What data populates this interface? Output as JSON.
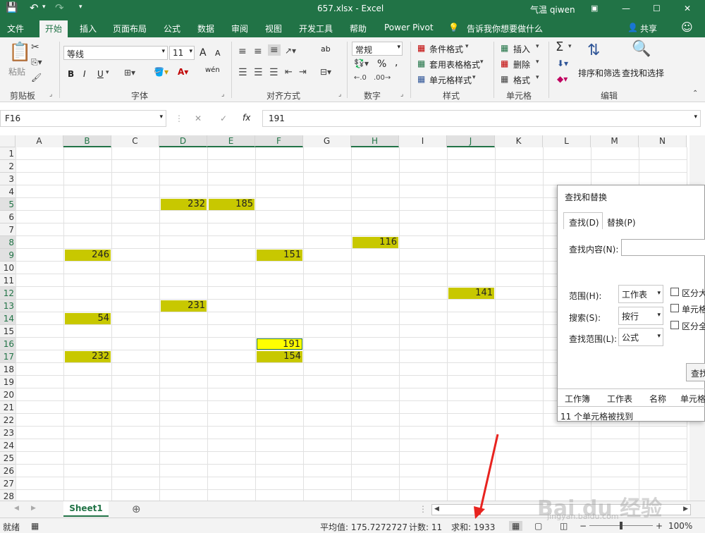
{
  "window": {
    "title": "657.xlsx  -  Excel",
    "user": "气温 qiwen",
    "buttons": {
      "minimize": "—",
      "restore": "☐",
      "close": "✕"
    }
  },
  "ribbon_tabs": [
    "文件",
    "开始",
    "插入",
    "页面布局",
    "公式",
    "数据",
    "审阅",
    "视图",
    "开发工具",
    "帮助",
    "Power Pivot"
  ],
  "tell_me": "告诉我你想要做什么",
  "share": "共享",
  "ribbon": {
    "clipboard": {
      "paste": "粘贴",
      "label": "剪贴板"
    },
    "font": {
      "name": "等线",
      "size": "11",
      "label": "字体",
      "bold": "B",
      "italic": "I",
      "underline": "U",
      "grow": "A",
      "shrink": "A",
      "wen": "wén"
    },
    "alignment": {
      "label": "对齐方式",
      "wrap": "ab"
    },
    "number": {
      "format": "常规",
      "label": "数字",
      "percent": "%",
      "comma": ","
    },
    "styles": {
      "conditional": "条件格式",
      "table": "套用表格格式",
      "cell": "单元格样式",
      "label": "样式"
    },
    "cells": {
      "insert": "插入",
      "delete": "删除",
      "format": "格式",
      "label": "单元格"
    },
    "editing": {
      "sort": "排序和筛选",
      "find": "查找和选择",
      "label": "编辑"
    }
  },
  "formula_bar": {
    "name_box": "F16",
    "cancel": "✕",
    "enter": "✓",
    "fx": "fx",
    "value": "191"
  },
  "sheet": {
    "columns": [
      "A",
      "B",
      "C",
      "D",
      "E",
      "F",
      "G",
      "H",
      "I",
      "J",
      "K",
      "L",
      "M",
      "N"
    ],
    "rows": [
      "1",
      "2",
      "3",
      "4",
      "5",
      "6",
      "7",
      "8",
      "9",
      "10",
      "11",
      "12",
      "13",
      "14",
      "15",
      "16",
      "17",
      "18",
      "19",
      "20",
      "21",
      "22",
      "23",
      "24",
      "25",
      "26",
      "27",
      "28"
    ],
    "cells": [
      {
        "ref": "D5",
        "value": "232"
      },
      {
        "ref": "E5",
        "value": "185"
      },
      {
        "ref": "H8",
        "value": "116"
      },
      {
        "ref": "B9",
        "value": "246"
      },
      {
        "ref": "F9",
        "value": "151"
      },
      {
        "ref": "J12",
        "value": "141"
      },
      {
        "ref": "D13",
        "value": "231"
      },
      {
        "ref": "B14",
        "value": "54"
      },
      {
        "ref": "F16",
        "value": "191"
      },
      {
        "ref": "B17",
        "value": "232"
      },
      {
        "ref": "F17",
        "value": "154"
      }
    ],
    "active_cell": "F16",
    "highlight_color": "#c8c800",
    "active_color": "#ffff00"
  },
  "dialog": {
    "title": "查找和替换",
    "tabs": [
      "查找(D)",
      "替换(P)"
    ],
    "find_label": "查找内容(N):",
    "scope_label": "范围(H):",
    "scope_value": "工作表",
    "search_label": "搜索(S):",
    "search_value": "按行",
    "lookin_label": "查找范围(L):",
    "lookin_value": "公式",
    "checkboxes": [
      "区分大",
      "单元格",
      "区分全"
    ],
    "find_button": "查找",
    "results_headers": [
      "工作簿",
      "工作表",
      "名称",
      "单元格"
    ],
    "status": "11 个单元格被找到"
  },
  "sheet_tab": "Sheet1",
  "status": {
    "mode": "就绪",
    "average": "平均值: 175.7272727",
    "count": "计数: 11",
    "sum": "求和: 1933",
    "zoom": "100%"
  },
  "watermark": {
    "brand": "Bai du 经验",
    "url": "jingyan.baidu.com"
  }
}
